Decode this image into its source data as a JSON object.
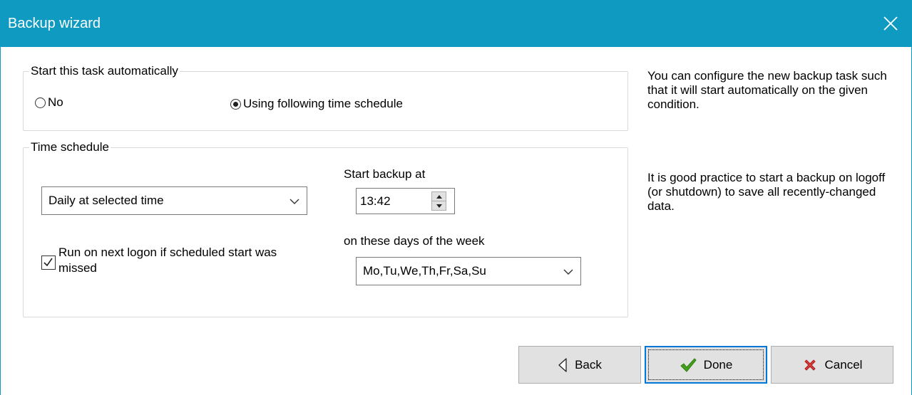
{
  "window": {
    "title": "Backup wizard"
  },
  "auto_start": {
    "legend": "Start this task automatically",
    "options": [
      {
        "label": "No",
        "selected": false
      },
      {
        "label": "Using following time schedule",
        "selected": true
      }
    ]
  },
  "schedule": {
    "legend": "Time schedule",
    "frequency": {
      "value": "Daily at selected time"
    },
    "start_label": "Start backup at",
    "start_time": "13:42",
    "days_label": "on these days of the week",
    "days": {
      "value": "Mo,Tu,We,Th,Fr,Sa,Su"
    },
    "missed": {
      "label": "Run on next logon if scheduled start was missed",
      "checked": true
    }
  },
  "help": {
    "p1": "You can configure the new backup task such that it will start automatically on the given condition.",
    "p2": "It is good practice to start a backup on logoff (or shutdown) to save all recently-changed data."
  },
  "buttons": {
    "back": "Back",
    "done": "Done",
    "cancel": "Cancel"
  },
  "colors": {
    "titlebar": "#0e9ac1",
    "accent": "#0078d7",
    "done_check": "#43a01a",
    "cancel_x": "#d93a3a"
  },
  "icons": {
    "close": "close-icon",
    "back": "back-arrow-icon",
    "done": "checkmark-icon",
    "cancel": "cancel-x-icon",
    "dropdown": "chevron-down-icon"
  }
}
